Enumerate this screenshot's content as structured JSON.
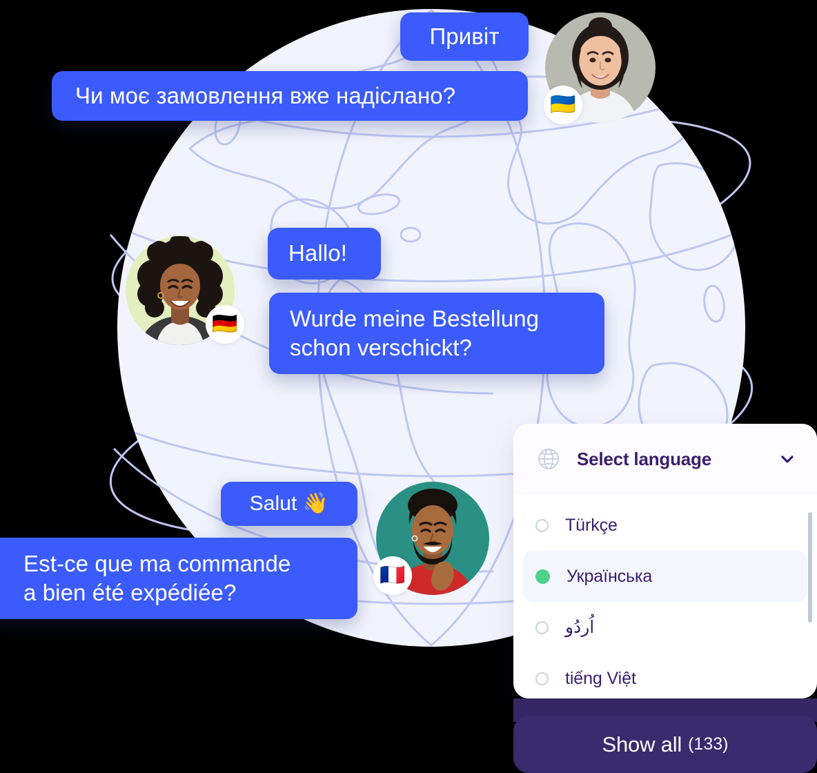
{
  "theme": {
    "bubble_blue": "#3B5BFD",
    "panel_white": "#FFFFFF",
    "title_purple": "#3A1E6E",
    "selected_green": "#4FD18C",
    "show_all_purple": "#3A2A6E",
    "globe_fill": "#F2F4FD",
    "globe_stroke": "#BFC6F2"
  },
  "conversations": [
    {
      "id": "ukrainian",
      "flag": "🇺🇦",
      "flag_name": "ukraine-flag",
      "avatar_name": "avatar-ukrainian-user",
      "avatar_bg": "#B9BAAF",
      "greeting": "Привіт",
      "question": "Чи моє замовлення вже надіслано?"
    },
    {
      "id": "german",
      "flag": "🇩🇪",
      "flag_name": "germany-flag",
      "avatar_name": "avatar-german-user",
      "avatar_bg": "#E3EFBE",
      "greeting": "Hallo!",
      "question_line1": "Wurde meine Bestellung",
      "question_line2": "schon verschickt?"
    },
    {
      "id": "french",
      "flag": "🇫🇷",
      "flag_name": "france-flag",
      "avatar_name": "avatar-french-user",
      "avatar_bg": "#2A9083",
      "greeting": "Salut 👋",
      "question_line1": "Est-ce que ma commande",
      "question_line2": "a bien été expédiée?"
    }
  ],
  "language_panel": {
    "icon": "globe-icon",
    "title": "Select language",
    "chevron": "chevron-down-icon",
    "options": [
      {
        "label": "Türkçe",
        "selected": false,
        "rtl": false
      },
      {
        "label": "Українська",
        "selected": true,
        "rtl": false
      },
      {
        "label": "اُردُو",
        "selected": false,
        "rtl": true
      },
      {
        "label": "tiếng Việt",
        "selected": false,
        "rtl": false
      }
    ],
    "show_all_label": "Show all",
    "show_all_count": "(133)"
  }
}
